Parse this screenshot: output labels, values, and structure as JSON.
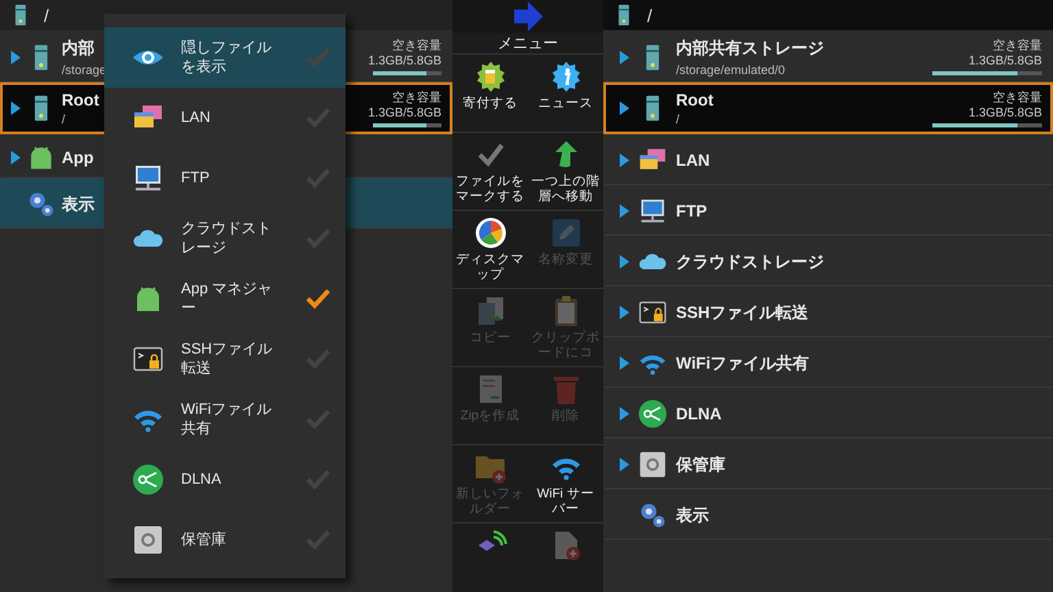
{
  "left_panel": {
    "path": "/",
    "rows": [
      {
        "kind": "storage",
        "title": "内部",
        "subtitle": "/storage",
        "free_label": "空き容量",
        "capacity": "1.3GB/5.8GB",
        "level": 0.78,
        "expandable": true,
        "focused": false,
        "selected": false
      },
      {
        "kind": "storage",
        "title": "Root",
        "subtitle": "/",
        "free_label": "空き容量",
        "capacity": "1.3GB/5.8GB",
        "level": 0.78,
        "expandable": true,
        "focused": true,
        "selected": false
      },
      {
        "kind": "plain",
        "title": "App",
        "expandable": true,
        "focused": false,
        "selected": false
      },
      {
        "kind": "plain",
        "title": "表示",
        "expandable": false,
        "focused": false,
        "selected": true
      }
    ]
  },
  "popup_menu": {
    "items": [
      {
        "label": "隠しファイルを表示",
        "checked": false,
        "selected": true
      },
      {
        "label": "LAN",
        "checked": false,
        "selected": false
      },
      {
        "label": "FTP",
        "checked": false,
        "selected": false
      },
      {
        "label": "クラウドストレージ",
        "checked": false,
        "selected": false
      },
      {
        "label": "App マネジャー",
        "checked": true,
        "selected": false
      },
      {
        "label": "SSHファイル転送",
        "checked": false,
        "selected": false
      },
      {
        "label": "WiFiファイル共有",
        "checked": false,
        "selected": false
      },
      {
        "label": "DLNA",
        "checked": false,
        "selected": false
      },
      {
        "label": "保管庫",
        "checked": false,
        "selected": false
      }
    ]
  },
  "toolbar": {
    "title": "メニュー",
    "buttons": [
      {
        "label": "寄付する",
        "disabled": false
      },
      {
        "label": "ニュース",
        "disabled": false
      },
      {
        "label": "ファイルをマークする",
        "disabled": false
      },
      {
        "label": "一つ上の階層へ移動",
        "disabled": false
      },
      {
        "label": "ディスクマップ",
        "disabled": false
      },
      {
        "label": "名称変更",
        "disabled": true
      },
      {
        "label": "コピー",
        "disabled": true
      },
      {
        "label": "クリップボードにコ",
        "disabled": true
      },
      {
        "label": "Zipを作成",
        "disabled": true
      },
      {
        "label": "削除",
        "disabled": true
      },
      {
        "label": "新しいフォルダー",
        "disabled": true
      },
      {
        "label": "WiFi サーバー",
        "disabled": false
      },
      {
        "disabled": false
      },
      {
        "disabled": true
      }
    ]
  },
  "right_panel": {
    "path": "/",
    "rows": [
      {
        "kind": "storage",
        "title": "内部共有ストレージ",
        "subtitle": "/storage/emulated/0",
        "free_label": "空き容量",
        "capacity": "1.3GB/5.8GB",
        "level": 0.78,
        "expandable": true,
        "focused": false,
        "selected": false
      },
      {
        "kind": "storage",
        "title": "Root",
        "subtitle": "/",
        "free_label": "空き容量",
        "capacity": "1.3GB/5.8GB",
        "level": 0.78,
        "expandable": true,
        "focused": true,
        "selected": false
      },
      {
        "kind": "plain",
        "title": "LAN",
        "expandable": true,
        "focused": false,
        "selected": false
      },
      {
        "kind": "plain",
        "title": "FTP",
        "expandable": true,
        "focused": false,
        "selected": false
      },
      {
        "kind": "plain",
        "title": "クラウドストレージ",
        "expandable": true,
        "focused": false,
        "selected": false
      },
      {
        "kind": "plain",
        "title": "SSHファイル転送",
        "expandable": true,
        "focused": false,
        "selected": false
      },
      {
        "kind": "plain",
        "title": "WiFiファイル共有",
        "expandable": true,
        "focused": false,
        "selected": false
      },
      {
        "kind": "plain",
        "title": "DLNA",
        "expandable": true,
        "focused": false,
        "selected": false
      },
      {
        "kind": "plain",
        "title": "保管庫",
        "expandable": true,
        "focused": false,
        "selected": false
      },
      {
        "kind": "plain",
        "title": "表示",
        "expandable": false,
        "focused": false,
        "selected": false
      }
    ]
  }
}
